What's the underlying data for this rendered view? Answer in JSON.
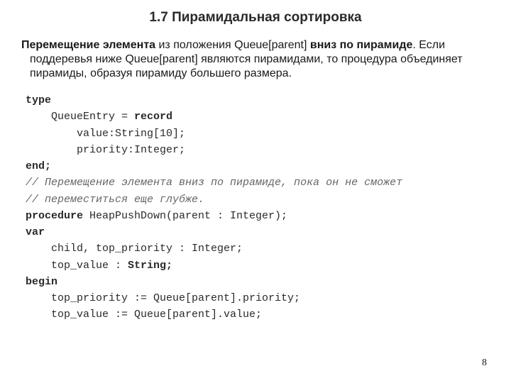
{
  "title": "1.7 Пирамидальная сортировка",
  "description": {
    "b1": "Перемещение элемента",
    "t1": " из положения Queue[parent] ",
    "b2": "вниз по пирамиде",
    "t2": ". Если поддеревья ниже Queue[parent] являются пирамидами, то процедура объединяет пирамиды, образуя пирамиду большего размера."
  },
  "code": {
    "l1_kw": "type",
    "l2a": "    QueueEntry = ",
    "l2b_kw": "record",
    "l3": "        value:String[10];",
    "l4": "        priority:Integer;",
    "l5_kw": "end;",
    "blank1": "",
    "l6": "// Перемещение элемента вниз по пирамиде, пока он не сможет",
    "l7": "// переместиться еще глубже.",
    "l8a_kw": "procedure",
    "l8b": " HeapPushDown(parent : Integer);",
    "l9_kw": "var",
    "l10": "    child, top_priority : Integer;",
    "l11a": "    top_value : ",
    "l11b_kw": "String;",
    "l12_kw": "begin",
    "l13": "    top_priority := Queue[parent].priority;",
    "l14": "    top_value := Queue[parent].value;"
  },
  "page_number": "8"
}
